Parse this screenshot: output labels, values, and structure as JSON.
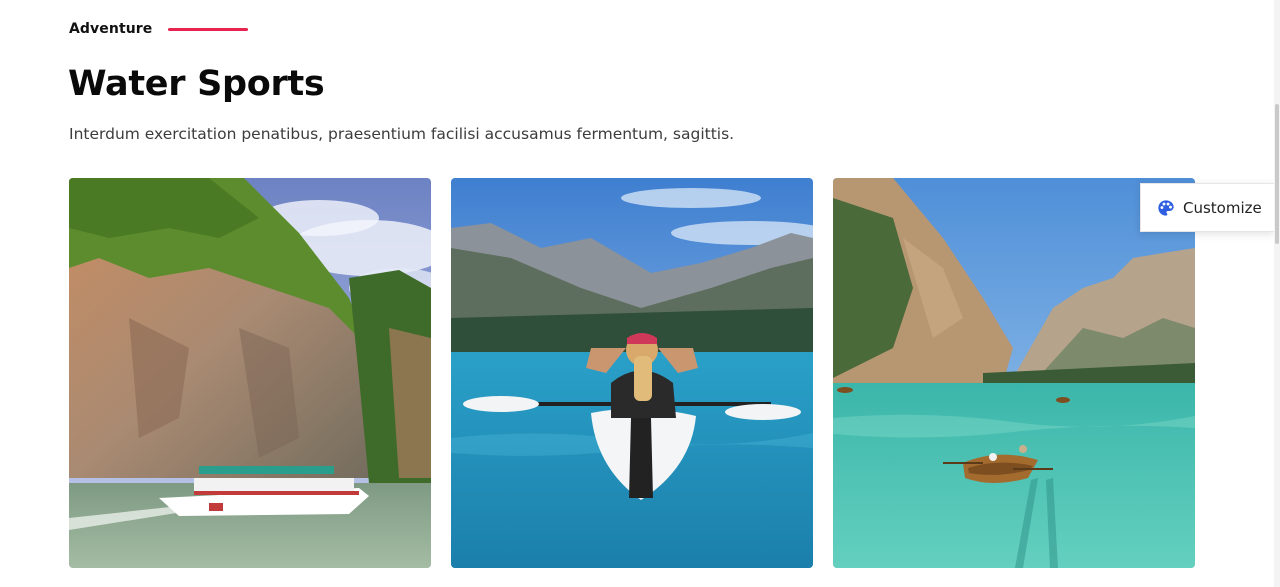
{
  "section": {
    "eyebrow": "Adventure",
    "title": "Water Sports",
    "subtitle": "Interdum exercitation penatibus, praesentium facilisi accusamus fermentum, sagittis."
  },
  "gallery": {
    "items": [
      {
        "icon": "limestone-cliff-boat-photo"
      },
      {
        "icon": "kayaker-lake-photo"
      },
      {
        "icon": "mountain-lake-rowboat-photo"
      }
    ]
  },
  "customize": {
    "label": "Customize",
    "icon": "palette-icon",
    "icon_color": "#2f5fe0"
  },
  "colors": {
    "accent": "#e8234f"
  }
}
